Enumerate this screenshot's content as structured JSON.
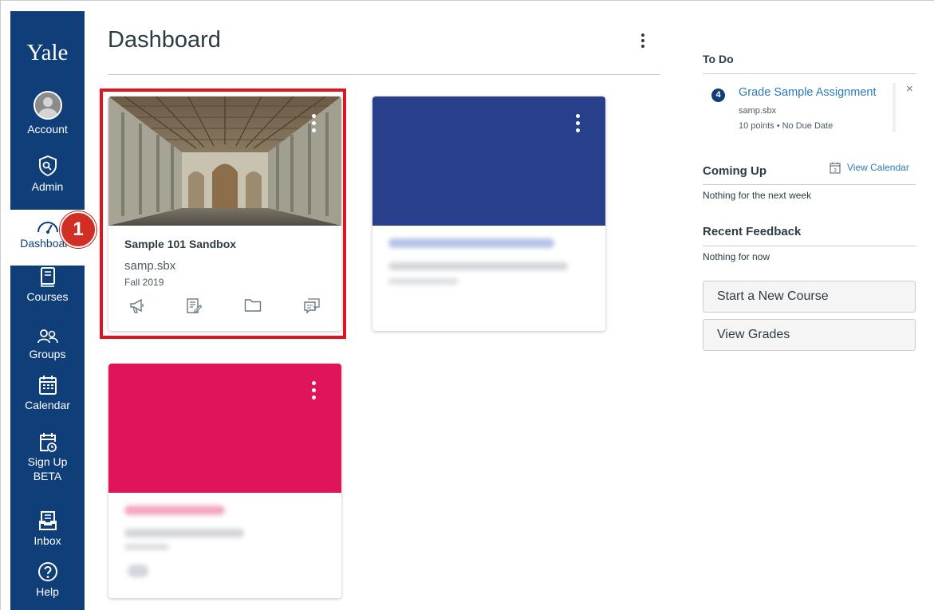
{
  "nav": {
    "logo": "Yale",
    "items": [
      {
        "label": "Account",
        "icon": "user-avatar"
      },
      {
        "label": "Admin",
        "icon": "shield-icon"
      },
      {
        "label": "Dashboard",
        "icon": "speedometer-icon",
        "active": true
      },
      {
        "label": "Courses",
        "icon": "book-icon"
      },
      {
        "label": "Groups",
        "icon": "people-icon"
      },
      {
        "label": "Calendar",
        "icon": "calendar-icon"
      },
      {
        "label": "Sign Up",
        "label2": "BETA",
        "icon": "calendar-clock-icon"
      },
      {
        "label": "Inbox",
        "icon": "inbox-icon"
      },
      {
        "label": "Help",
        "icon": "help-icon"
      }
    ]
  },
  "step_badge": "1",
  "header": {
    "title": "Dashboard"
  },
  "cards": [
    {
      "name": "Sample 101 Sandbox",
      "code": "samp.sbx",
      "term": "Fall 2019",
      "hero": "cathedral-photo",
      "icons": [
        "announcements-icon",
        "assignments-icon",
        "files-icon",
        "discussions-icon"
      ]
    },
    {
      "hero_color": "#283f8b",
      "blurred": true
    },
    {
      "hero_color": "#e0145b",
      "blurred": true
    }
  ],
  "sidebar": {
    "todo_heading": "To Do",
    "todo_item": {
      "badge": "4",
      "title": "Grade Sample Assignment",
      "course": "samp.sbx",
      "meta": "10 points • No Due Date",
      "close": "×"
    },
    "coming_up_heading": "Coming Up",
    "calendar_icon_day": "3",
    "view_calendar": "View Calendar",
    "coming_up_note": "Nothing for the next week",
    "feedback_heading": "Recent Feedback",
    "feedback_note": "Nothing for now",
    "start_course_btn": "Start a New Course",
    "view_grades_btn": "View Grades"
  },
  "colors": {
    "nav_bg": "#0f3e79",
    "link": "#2b7abc",
    "highlight": "#e0141e"
  }
}
